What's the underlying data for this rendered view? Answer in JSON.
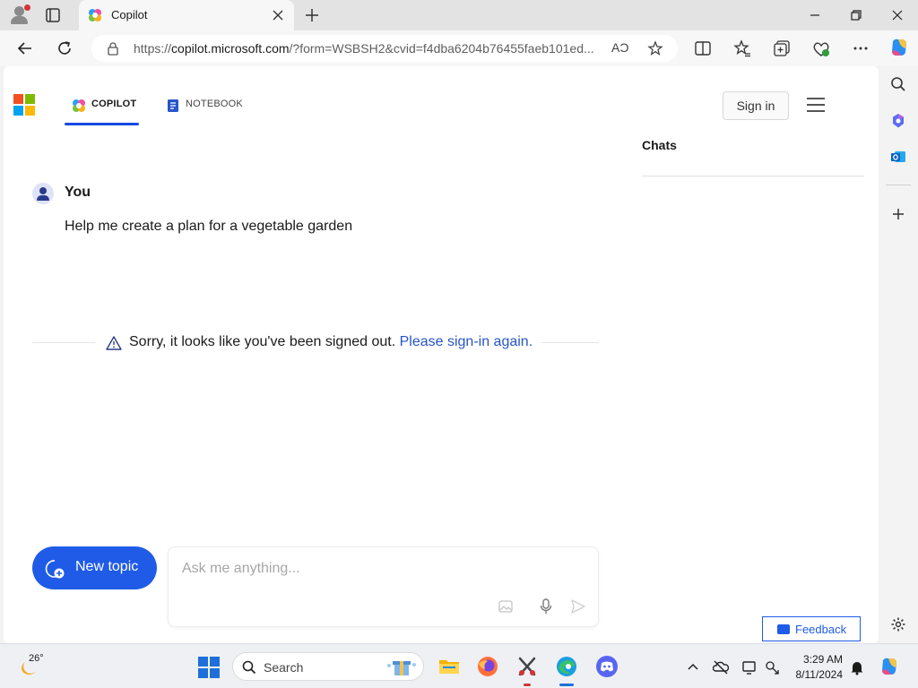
{
  "browser": {
    "tab_title": "Copilot",
    "url_prefix": "https://",
    "url_domain": "copilot.microsoft.com",
    "url_rest": "/?form=WSBSH2&cvid=f4dba6204b76455faeb101ed...",
    "read_aloud_glyph": "AƆ"
  },
  "header": {
    "tabs": [
      {
        "label": "COPILOT",
        "icon": "copilot-icon",
        "active": true
      },
      {
        "label": "NOTEBOOK",
        "icon": "notebook-icon",
        "active": false
      }
    ],
    "sign_in_label": "Sign in"
  },
  "chats": {
    "title": "Chats"
  },
  "conversation": {
    "author": "You",
    "message": "Help me create a plan for a vegetable garden",
    "notice_text": "Sorry, it looks like you've been signed out.",
    "notice_link": "Please sign-in again."
  },
  "composer": {
    "new_topic_label": "New topic",
    "placeholder": "Ask me anything..."
  },
  "feedback_label": "Feedback",
  "taskbar": {
    "weather_temp": "26°",
    "search_label": "Search",
    "time": "3:29 AM",
    "date": "8/11/2024"
  },
  "colors": {
    "accent": "#1f5be7",
    "link": "#2855c7",
    "tab_underline": "#174ae4"
  }
}
